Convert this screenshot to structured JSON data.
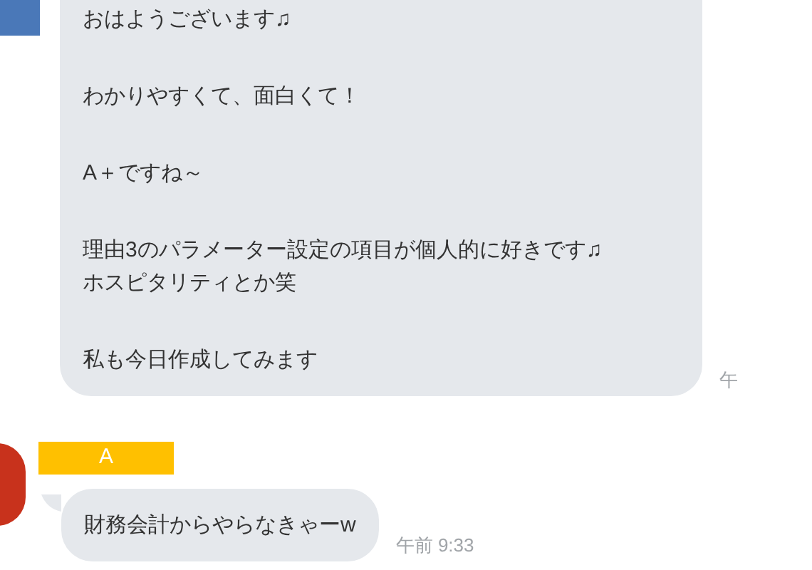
{
  "messages": [
    {
      "paragraphs": [
        [
          "おはようございます♫"
        ],
        [
          "わかりやすくて、面白くて！"
        ],
        [
          "A＋ですね～"
        ],
        [
          "理由3のパラメーター設定の項目が個人的に好きです♫",
          "ホスピタリティとか笑"
        ],
        [
          "私も今日作成してみます"
        ]
      ],
      "time": "午"
    },
    {
      "sender": "A",
      "paragraphs": [
        [
          "財務会計からやらなきゃーw"
        ]
      ],
      "time": "午前 9:33"
    }
  ]
}
